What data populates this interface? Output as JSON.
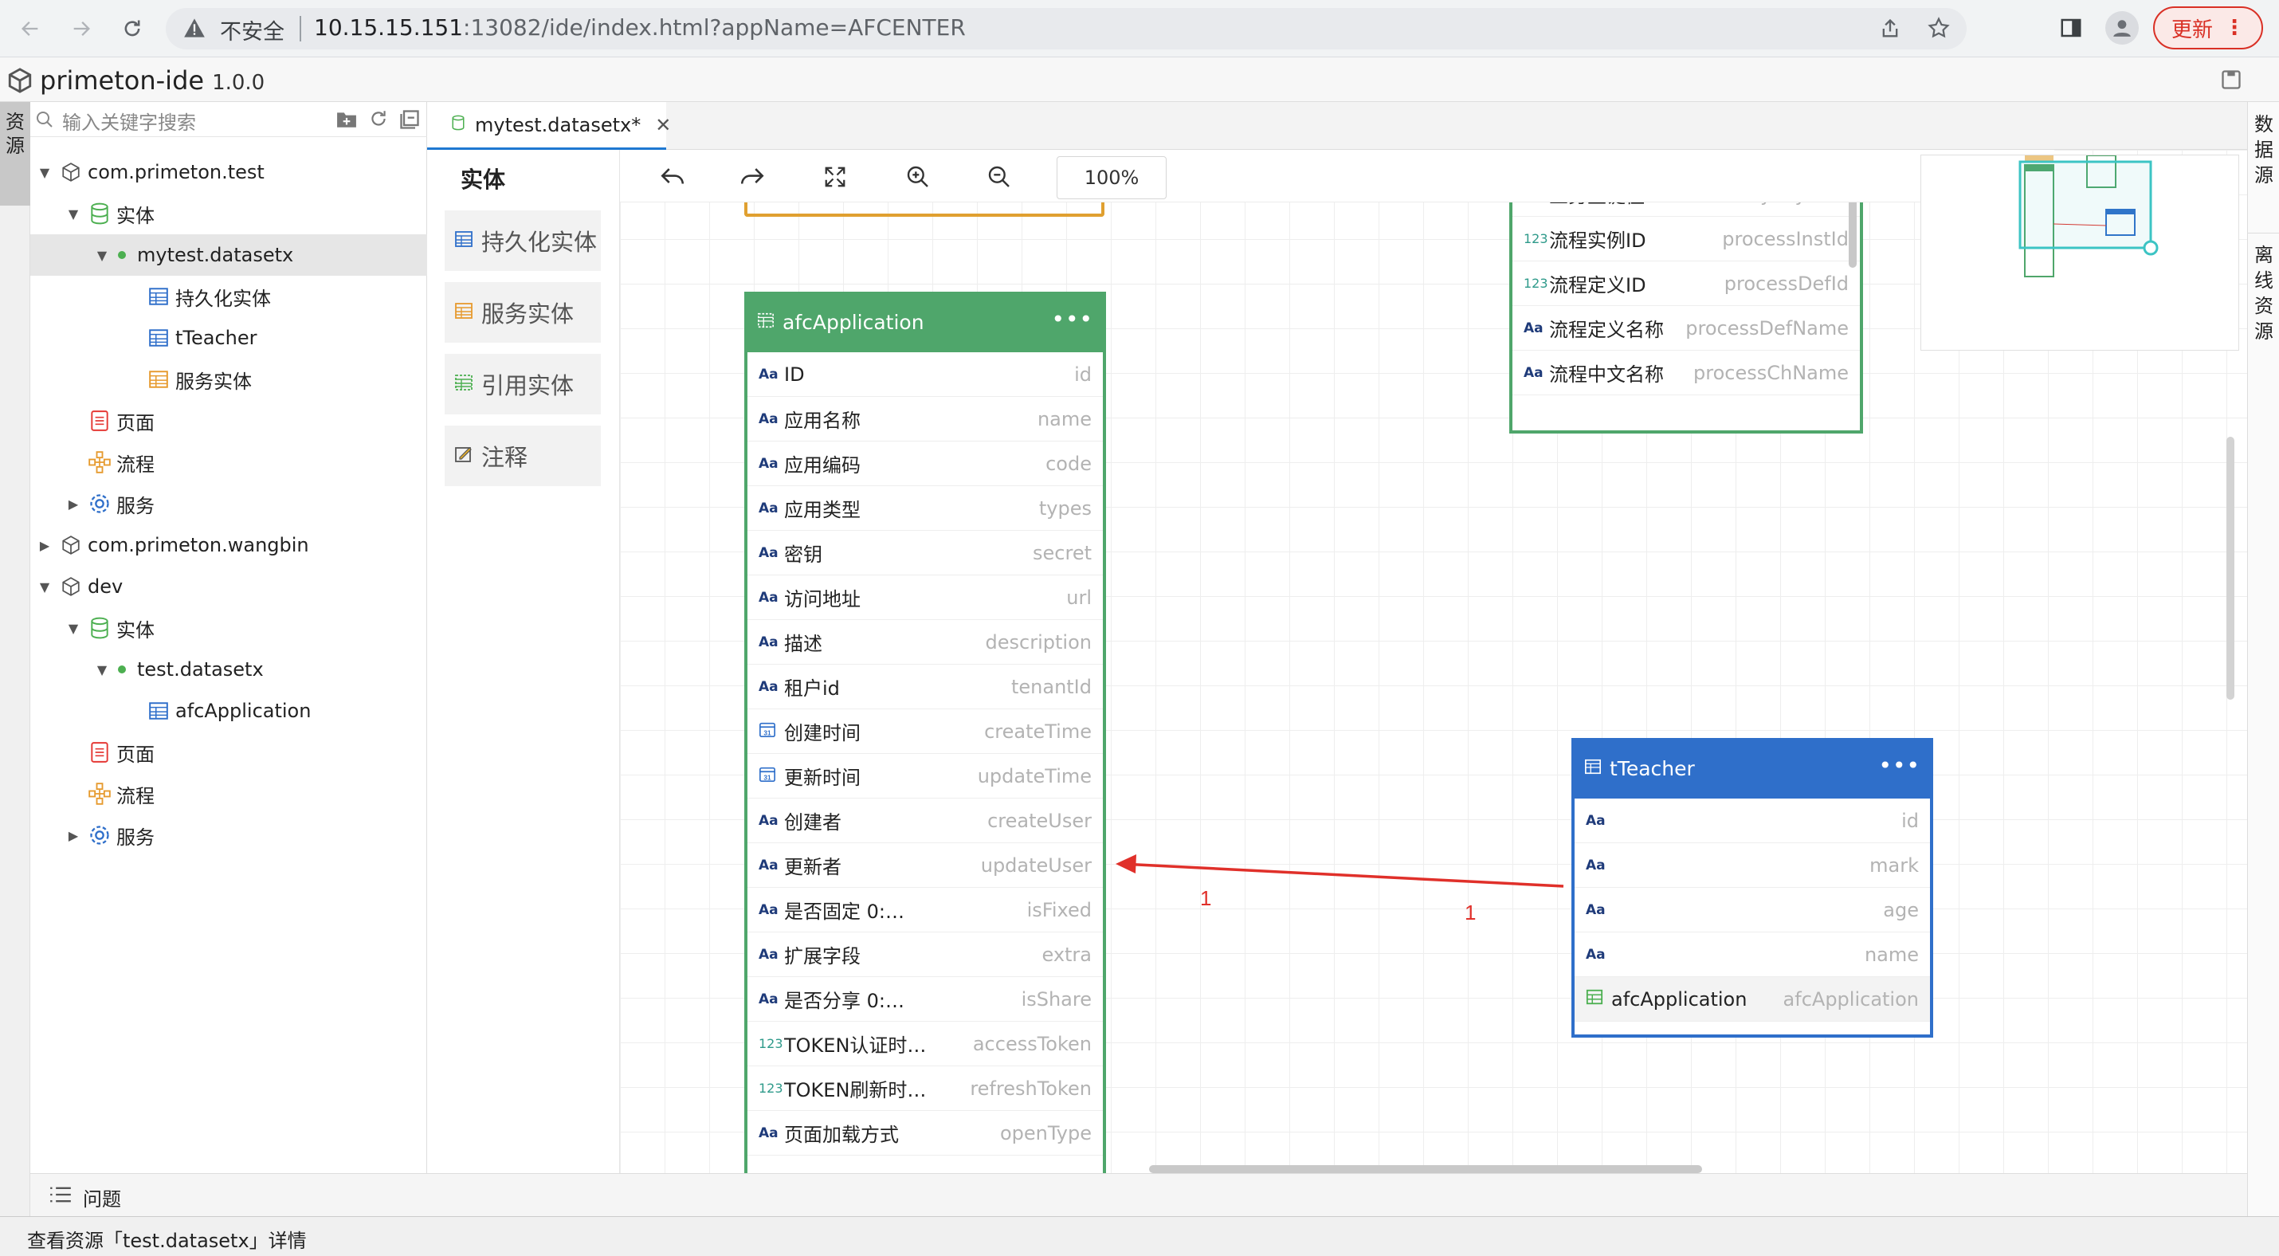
{
  "browser": {
    "insecure_label": "不安全",
    "url_host": "10.15.15.151",
    "url_rest": ":13082/ide/index.html?appName=AFCENTER",
    "update_label": "更新"
  },
  "app": {
    "title": "primeton-ide",
    "version": "1.0.0"
  },
  "left_tab": {
    "label": "资源"
  },
  "right_tabs": [
    {
      "label": "数据源"
    },
    {
      "label": "离线资源"
    }
  ],
  "search": {
    "placeholder": "输入关键字搜索"
  },
  "tree": [
    {
      "label": "com.primeton.test"
    },
    {
      "label": "实体"
    },
    {
      "label": "mytest.datasetx"
    },
    {
      "label": "持久化实体"
    },
    {
      "label": "tTeacher"
    },
    {
      "label": "服务实体"
    },
    {
      "label": "页面"
    },
    {
      "label": "流程"
    },
    {
      "label": "服务"
    },
    {
      "label": "com.primeton.wangbin"
    },
    {
      "label": "dev"
    },
    {
      "label": "实体"
    },
    {
      "label": "test.datasetx"
    },
    {
      "label": "afcApplication"
    },
    {
      "label": "页面"
    },
    {
      "label": "流程"
    },
    {
      "label": "服务"
    }
  ],
  "editor": {
    "tab_label": "mytest.datasetx*"
  },
  "palette": {
    "title": "实体",
    "items": [
      {
        "label": "持久化实体"
      },
      {
        "label": "服务实体"
      },
      {
        "label": "引用实体"
      },
      {
        "label": "注释"
      }
    ]
  },
  "toolbar": {
    "zoom": "100%"
  },
  "entities": {
    "afcApplication": {
      "title": "afcApplication",
      "color": "#4fa66b",
      "fields": [
        {
          "type": "Aa",
          "label": "ID",
          "name": "id"
        },
        {
          "type": "Aa",
          "label": "应用名称",
          "name": "name"
        },
        {
          "type": "Aa",
          "label": "应用编码",
          "name": "code"
        },
        {
          "type": "Aa",
          "label": "应用类型",
          "name": "types"
        },
        {
          "type": "Aa",
          "label": "密钥",
          "name": "secret"
        },
        {
          "type": "Aa",
          "label": "访问地址",
          "name": "url"
        },
        {
          "type": "Aa",
          "label": "描述",
          "name": "description"
        },
        {
          "type": "Aa",
          "label": "租户id",
          "name": "tenantId"
        },
        {
          "type": "31",
          "label": "创建时间",
          "name": "createTime"
        },
        {
          "type": "31",
          "label": "更新时间",
          "name": "updateTime"
        },
        {
          "type": "Aa",
          "label": "创建者",
          "name": "createUser"
        },
        {
          "type": "Aa",
          "label": "更新者",
          "name": "updateUser"
        },
        {
          "type": "Aa",
          "label": "是否固定 0:…",
          "name": "isFixed"
        },
        {
          "type": "Aa",
          "label": "扩展字段",
          "name": "extra"
        },
        {
          "type": "Aa",
          "label": "是否分享 0:…",
          "name": "isShare"
        },
        {
          "type": "123",
          "label": "TOKEN认证时…",
          "name": "accessToken"
        },
        {
          "type": "123",
          "label": "TOKEN刷新时…",
          "name": "refreshToken"
        },
        {
          "type": "Aa",
          "label": "页面加载方式",
          "name": "openType"
        }
      ]
    },
    "process": {
      "color": "#4fa66b",
      "fields": [
        {
          "type": "Aa",
          "label": "业务主键值",
          "name": "bizPrimaryKeyVa…"
        },
        {
          "type": "123",
          "label": "流程实例ID",
          "name": "processInstId"
        },
        {
          "type": "123",
          "label": "流程定义ID",
          "name": "processDefId"
        },
        {
          "type": "Aa",
          "label": "流程定义名称",
          "name": "processDefName"
        },
        {
          "type": "Aa",
          "label": "流程中文名称",
          "name": "processChName"
        }
      ]
    },
    "tTeacher": {
      "title": "tTeacher",
      "color": "#2f6fca",
      "fields": [
        {
          "type": "Aa",
          "label": "",
          "name": "id"
        },
        {
          "type": "Aa",
          "label": "",
          "name": "mark"
        },
        {
          "type": "Aa",
          "label": "",
          "name": "age"
        },
        {
          "type": "Aa",
          "label": "",
          "name": "name"
        },
        {
          "type": "ref",
          "label": "afcApplication",
          "name": "afcApplication"
        }
      ]
    }
  },
  "relation": {
    "from_multiplicity": "1",
    "to_multiplicity": "1",
    "color": "#e0302a"
  },
  "problems": {
    "label": "问题"
  },
  "status": {
    "text": "查看资源「test.datasetx」详情"
  }
}
